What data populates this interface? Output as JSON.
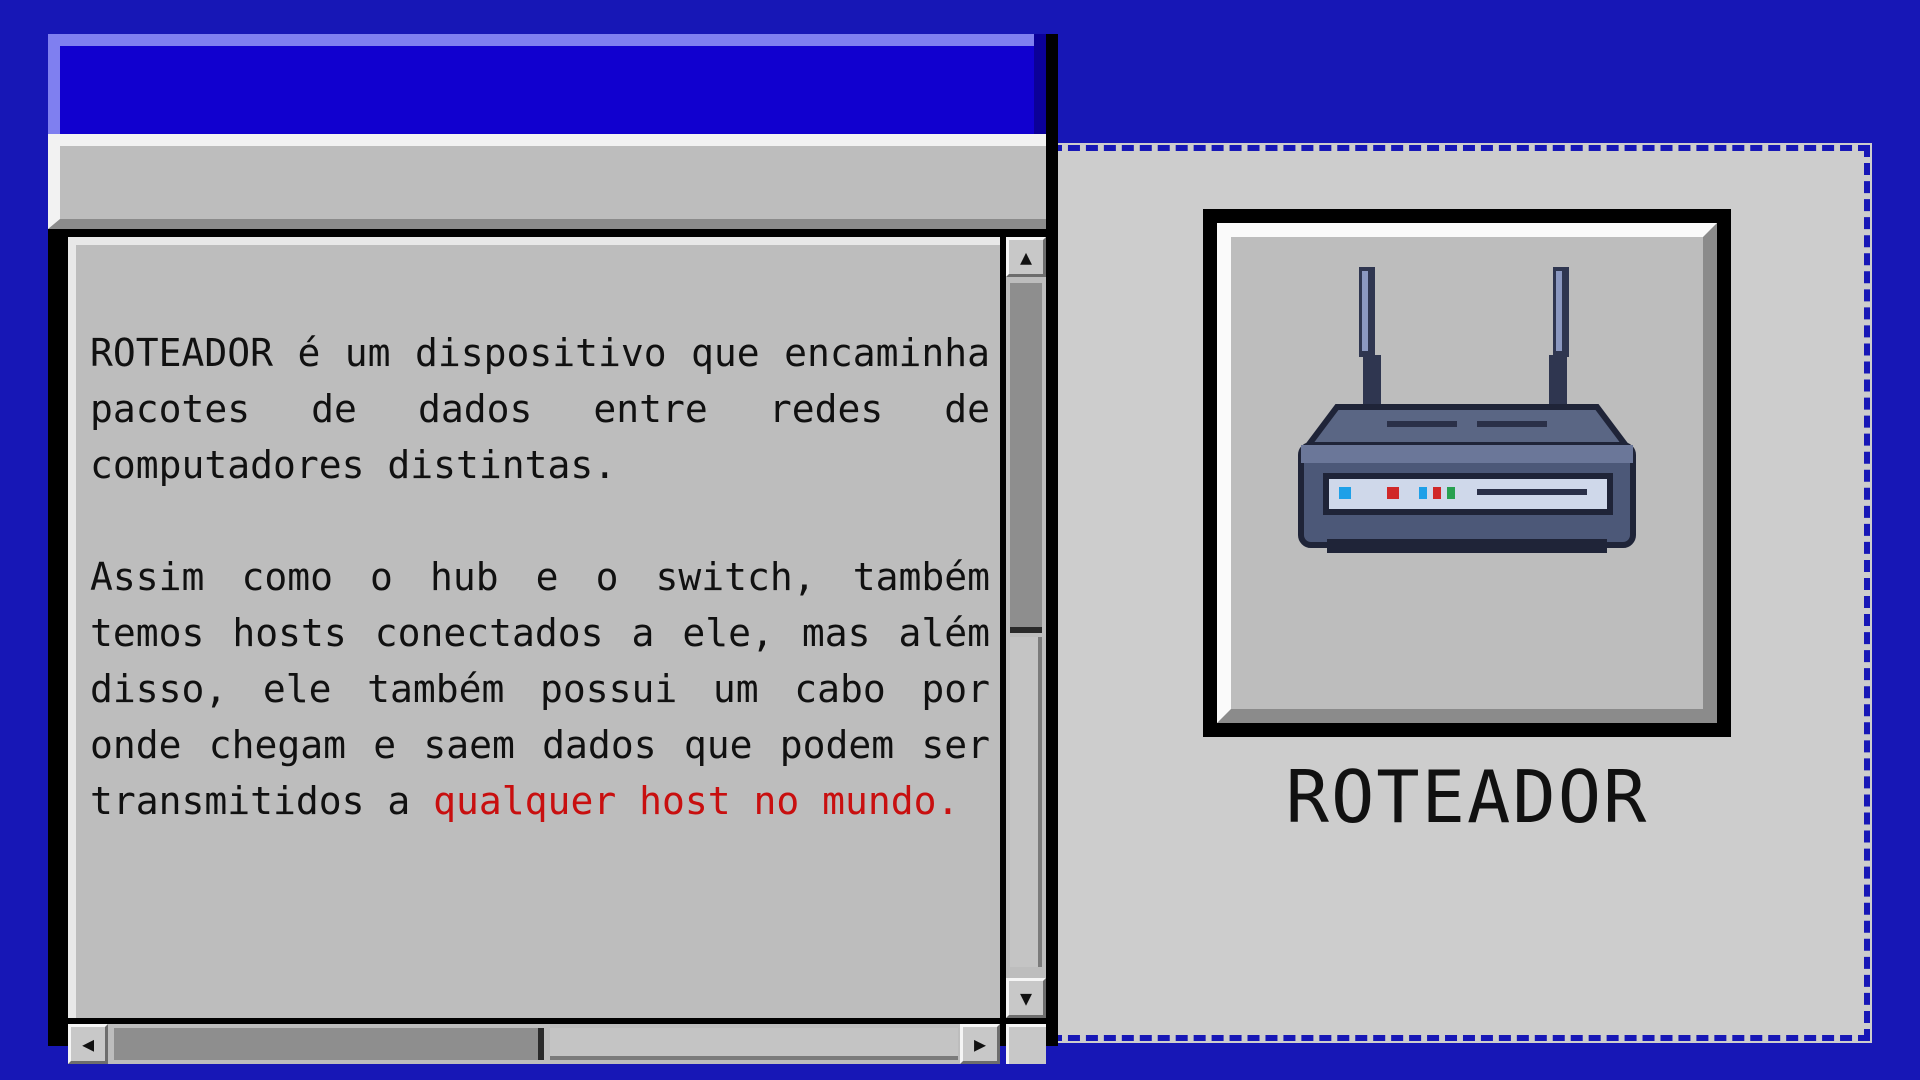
{
  "window": {
    "body": {
      "paragraph1": "ROTEADOR é um dispositivo que encaminha pacotes de dados entre redes de computadores distintas.",
      "paragraph2_plain": "Assim como o hub e o switch, também temos hosts conectados a ele, mas além disso, ele também possui um cabo por onde chegam e saem dados que podem ser transmitidos a ",
      "paragraph2_highlight": "qualquer host no mundo."
    },
    "scrollbar": {
      "up_icon": "▲",
      "down_icon": "▼",
      "left_icon": "◀",
      "right_icon": "▶"
    }
  },
  "side_panel": {
    "image_icon": "router-icon",
    "caption": "ROTEADOR"
  },
  "colors": {
    "background": "#1717b6",
    "titlebar": "#1100cf",
    "panel": "#cdcdcd",
    "highlight_text": "#c80f0f"
  }
}
